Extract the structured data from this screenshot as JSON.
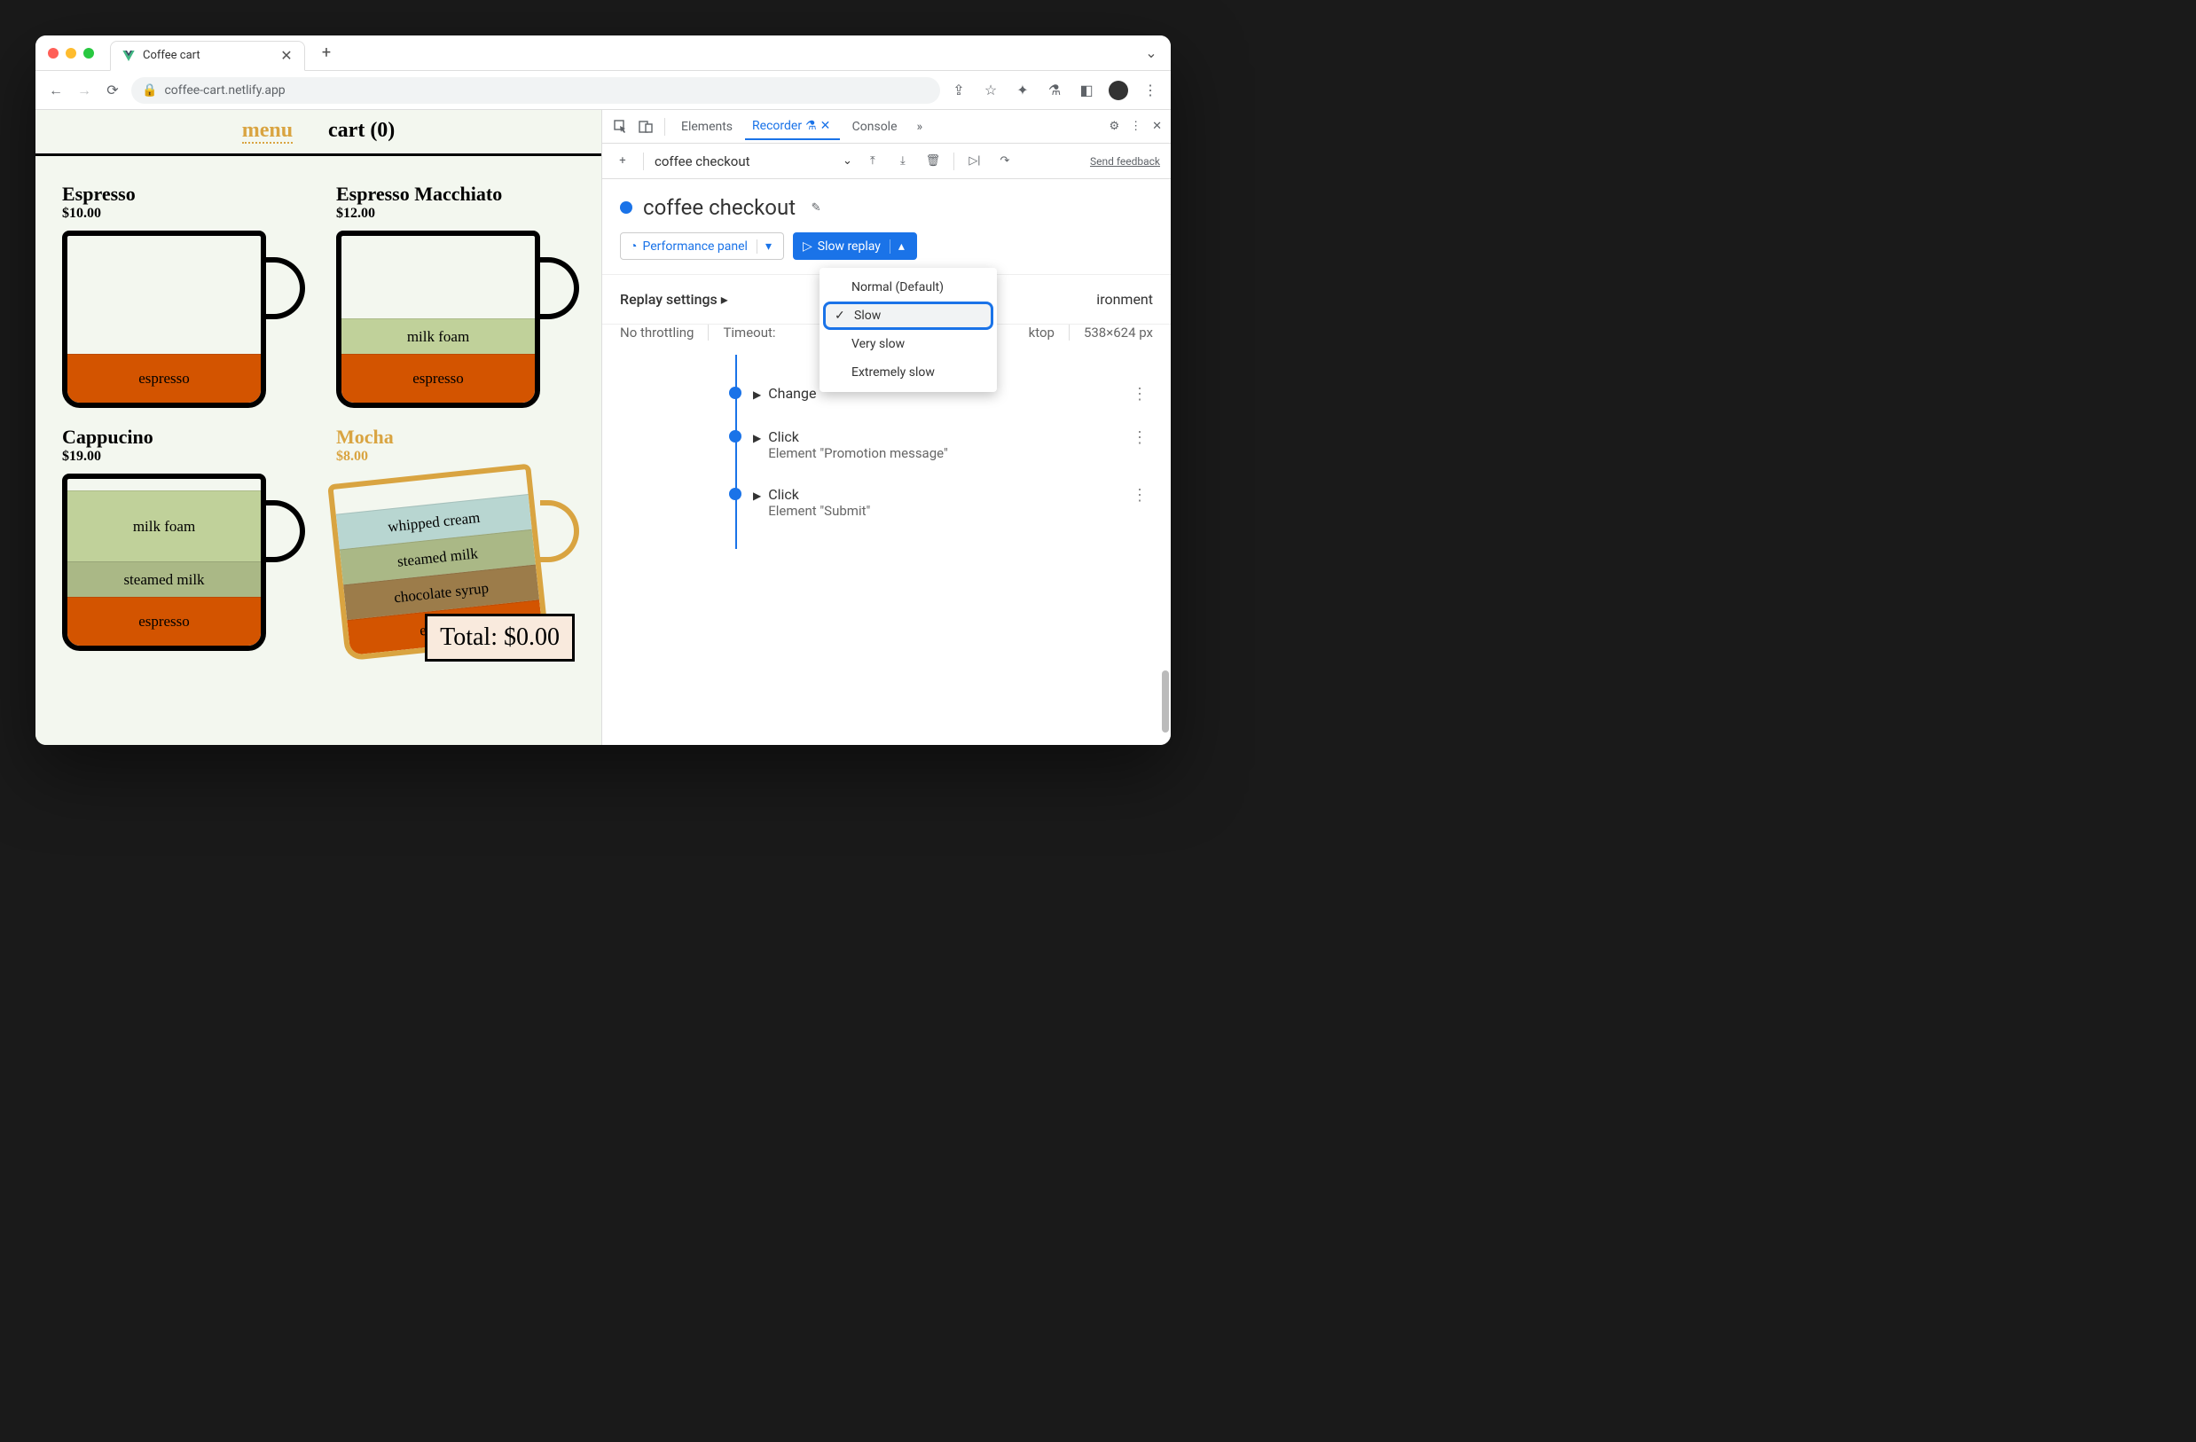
{
  "browser": {
    "tab_title": "Coffee cart",
    "url": "coffee-cart.netlify.app"
  },
  "page": {
    "nav": {
      "menu": "menu",
      "cart": "cart (0)"
    },
    "products": [
      {
        "name": "Espresso",
        "price": "$10.00"
      },
      {
        "name": "Espresso Macchiato",
        "price": "$12.00"
      },
      {
        "name": "Cappucino",
        "price": "$19.00"
      },
      {
        "name": "Mocha",
        "price": "$8.00"
      }
    ],
    "layers": {
      "espresso": "espresso",
      "milk_foam": "milk foam",
      "steamed_milk": "steamed milk",
      "whipped_cream": "whipped cream",
      "chocolate_syrup": "chocolate syrup"
    },
    "total_label": "Total: $0.00"
  },
  "devtools": {
    "tabs": {
      "elements": "Elements",
      "recorder": "Recorder",
      "console": "Console"
    },
    "recording_selector": "coffee checkout",
    "feedback": "Send feedback",
    "recording_name": "coffee checkout",
    "perf_btn": "Performance panel",
    "replay_btn": "Slow replay",
    "dropdown": {
      "normal": "Normal (Default)",
      "slow": "Slow",
      "very_slow": "Very slow",
      "extremely_slow": "Extremely slow"
    },
    "settings": {
      "title": "Replay settings",
      "throttling": "No throttling",
      "timeout_label": "Timeout:",
      "env_label_partial": "ironment",
      "device": "ktop",
      "dimensions": "538×624 px"
    },
    "steps": [
      {
        "title": "Change",
        "sub": ""
      },
      {
        "title": "Click",
        "sub": "Element \"Promotion message\""
      },
      {
        "title": "Click",
        "sub": "Element \"Submit\""
      }
    ]
  }
}
